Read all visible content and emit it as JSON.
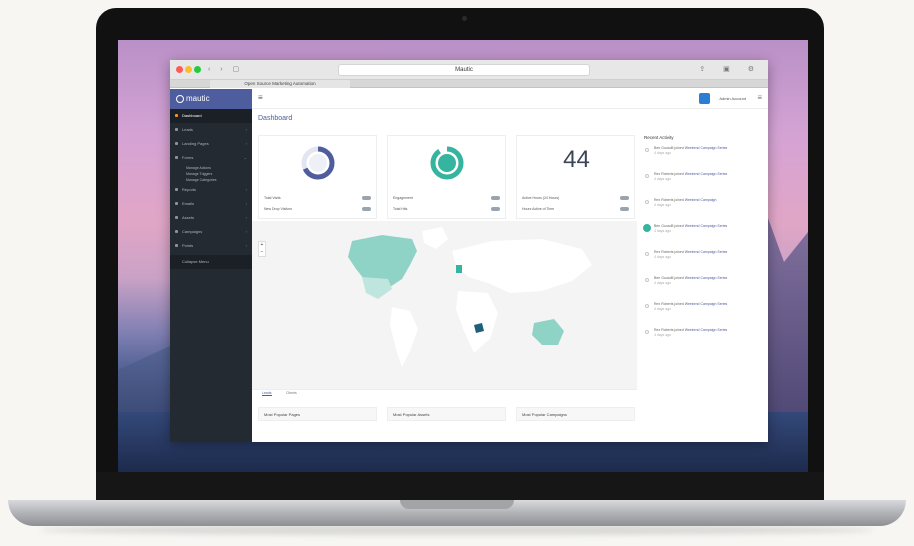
{
  "browser": {
    "address": "Mautic",
    "tab_label": "Open Source Marketing Automation"
  },
  "sidebar": {
    "logo": "mautic",
    "items": [
      {
        "label": "Dashboard",
        "active": true
      },
      {
        "label": "Leads"
      },
      {
        "label": "Landing Pages"
      },
      {
        "label": "Forms"
      },
      {
        "label": "Reports"
      },
      {
        "label": "Emails"
      },
      {
        "label": "Assets"
      },
      {
        "label": "Campaigns"
      },
      {
        "label": "Points"
      }
    ],
    "sub_items": [
      "Manage Actions",
      "Manage Triggers",
      "Manage Categories"
    ],
    "collapse_label": "Collapse Menu"
  },
  "header": {
    "user_name": "Admin Account"
  },
  "main": {
    "title": "Dashboard",
    "cards": [
      {
        "type": "donut-blue",
        "rows": [
          "Total Visits",
          "New Drop Visitors"
        ]
      },
      {
        "type": "donut-teal",
        "rows": [
          "Engagement",
          "Total Hits"
        ]
      },
      {
        "type": "number",
        "value": "44",
        "rows": [
          "Active Hours (24 Hours)",
          "Hours Active of Time"
        ]
      }
    ],
    "map_tabs": [
      "Leads",
      "Clients"
    ],
    "bottom_cards": [
      "Most Popular Pages",
      "Most Popular Assets",
      "Most Popular Campaigns"
    ]
  },
  "activity": {
    "title": "Recent Activity",
    "items": [
      {
        "text": "Ben Gousd5 joined ",
        "link": "Weekend Campaign Series",
        "time": "4 days ago"
      },
      {
        "text": "Rex Roberts joined ",
        "link": "Weekend Campaign Series",
        "time": "4 days ago"
      },
      {
        "text": "Rex Roberts joined ",
        "link": "Weekend Campaign",
        "time": "4 days ago"
      },
      {
        "text": "Ben Gousd5 joined ",
        "link": "Weekend Campaign Series",
        "time": "4 days ago",
        "highlight": true
      },
      {
        "text": "Rex Roberts joined ",
        "link": "Weekend Campaign Series",
        "time": "4 days ago"
      },
      {
        "text": "Ben Gousd5 joined ",
        "link": "Weekend Campaign Series",
        "time": "4 days ago"
      },
      {
        "text": "Rex Roberts joined ",
        "link": "Weekend Campaign Series",
        "time": "4 days ago"
      },
      {
        "text": "Rex Roberts joined ",
        "link": "Weekend Campaign Series",
        "time": "4 days ago"
      }
    ]
  },
  "colors": {
    "brand": "#4e5d9d",
    "teal": "#35b49f",
    "sidebar": "#242a32",
    "accent_orange": "#f5912b"
  }
}
